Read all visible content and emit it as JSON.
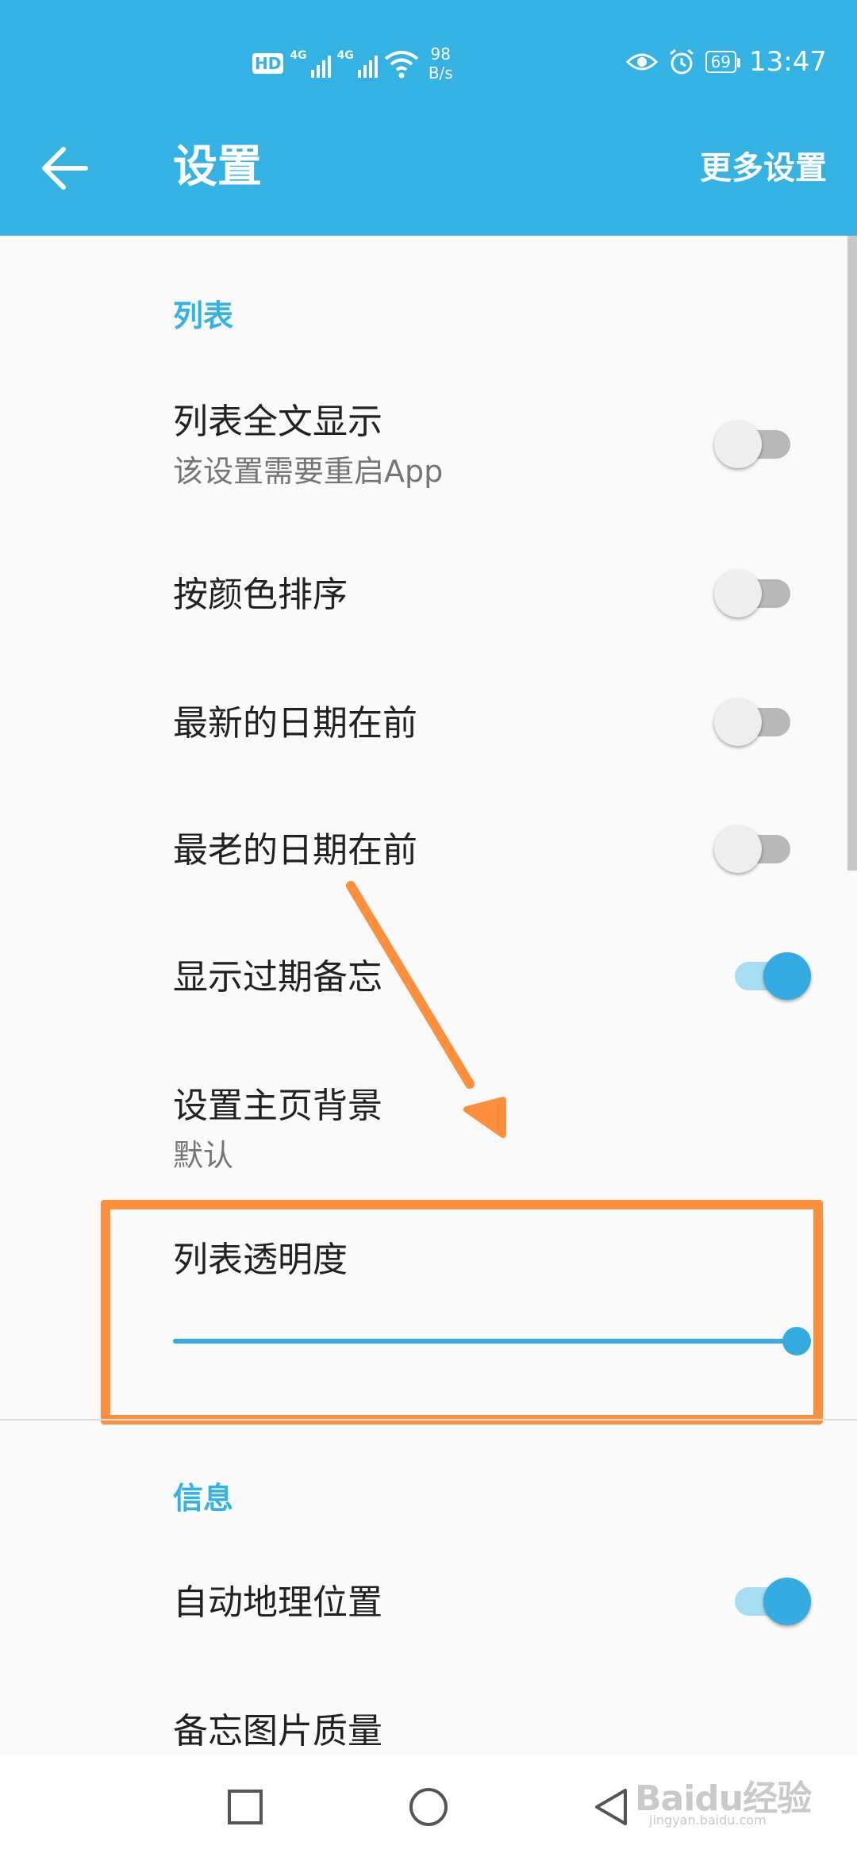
{
  "status_bar": {
    "hd": "HD",
    "sim1_label": "4G",
    "sim2_label": "4G",
    "speed_value": "98",
    "speed_unit": "B/s",
    "battery": "69",
    "time": "13:47"
  },
  "toolbar": {
    "title": "设置",
    "more_label": "更多设置"
  },
  "sections": {
    "list": {
      "header": "列表",
      "full_text": {
        "title": "列表全文显示",
        "subtitle": "该设置需要重启App",
        "on": false
      },
      "sort_color": {
        "title": "按颜色排序",
        "on": false
      },
      "newest_first": {
        "title": "最新的日期在前",
        "on": false
      },
      "oldest_first": {
        "title": "最老的日期在前",
        "on": false
      },
      "show_expired": {
        "title": "显示过期备忘",
        "on": true
      },
      "home_bg": {
        "title": "设置主页背景",
        "subtitle": "默认"
      },
      "transparency": {
        "title": "列表透明度",
        "level": 1.0
      }
    },
    "info": {
      "header": "信息",
      "auto_location": {
        "title": "自动地理位置",
        "on": true
      },
      "image_quality": {
        "title": "备忘图片质量"
      }
    }
  },
  "watermark": {
    "logo": "Baidu经验",
    "sub": "jingyan.baidu.com"
  },
  "colors": {
    "accent": "#34b2e4",
    "highlight": "#ff8f3d"
  }
}
